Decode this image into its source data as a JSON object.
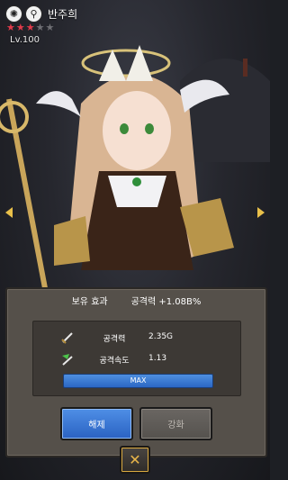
{
  "character": {
    "name": "반주희",
    "level": "Lv.100",
    "stars_filled": 3,
    "stars_total": 5
  },
  "icons": {
    "emblem": "sun-emblem-icon",
    "profile": "search-profile-icon"
  },
  "panel": {
    "title": "보유 효과",
    "effect": "공격력 +1.08B%",
    "stats": [
      {
        "icon": "sword-icon",
        "label": "공격력",
        "value": "2.35G"
      },
      {
        "icon": "speed-sword-icon",
        "label": "공격속도",
        "value": "1.13"
      }
    ],
    "max_label": "MAX",
    "release_button": "해제",
    "enhance_button": "강화"
  },
  "colors": {
    "accent_blue": "#2f6fd0",
    "gold": "#e9c04a",
    "star_red": "#e23a4a",
    "panel_bg": "#55504a"
  }
}
